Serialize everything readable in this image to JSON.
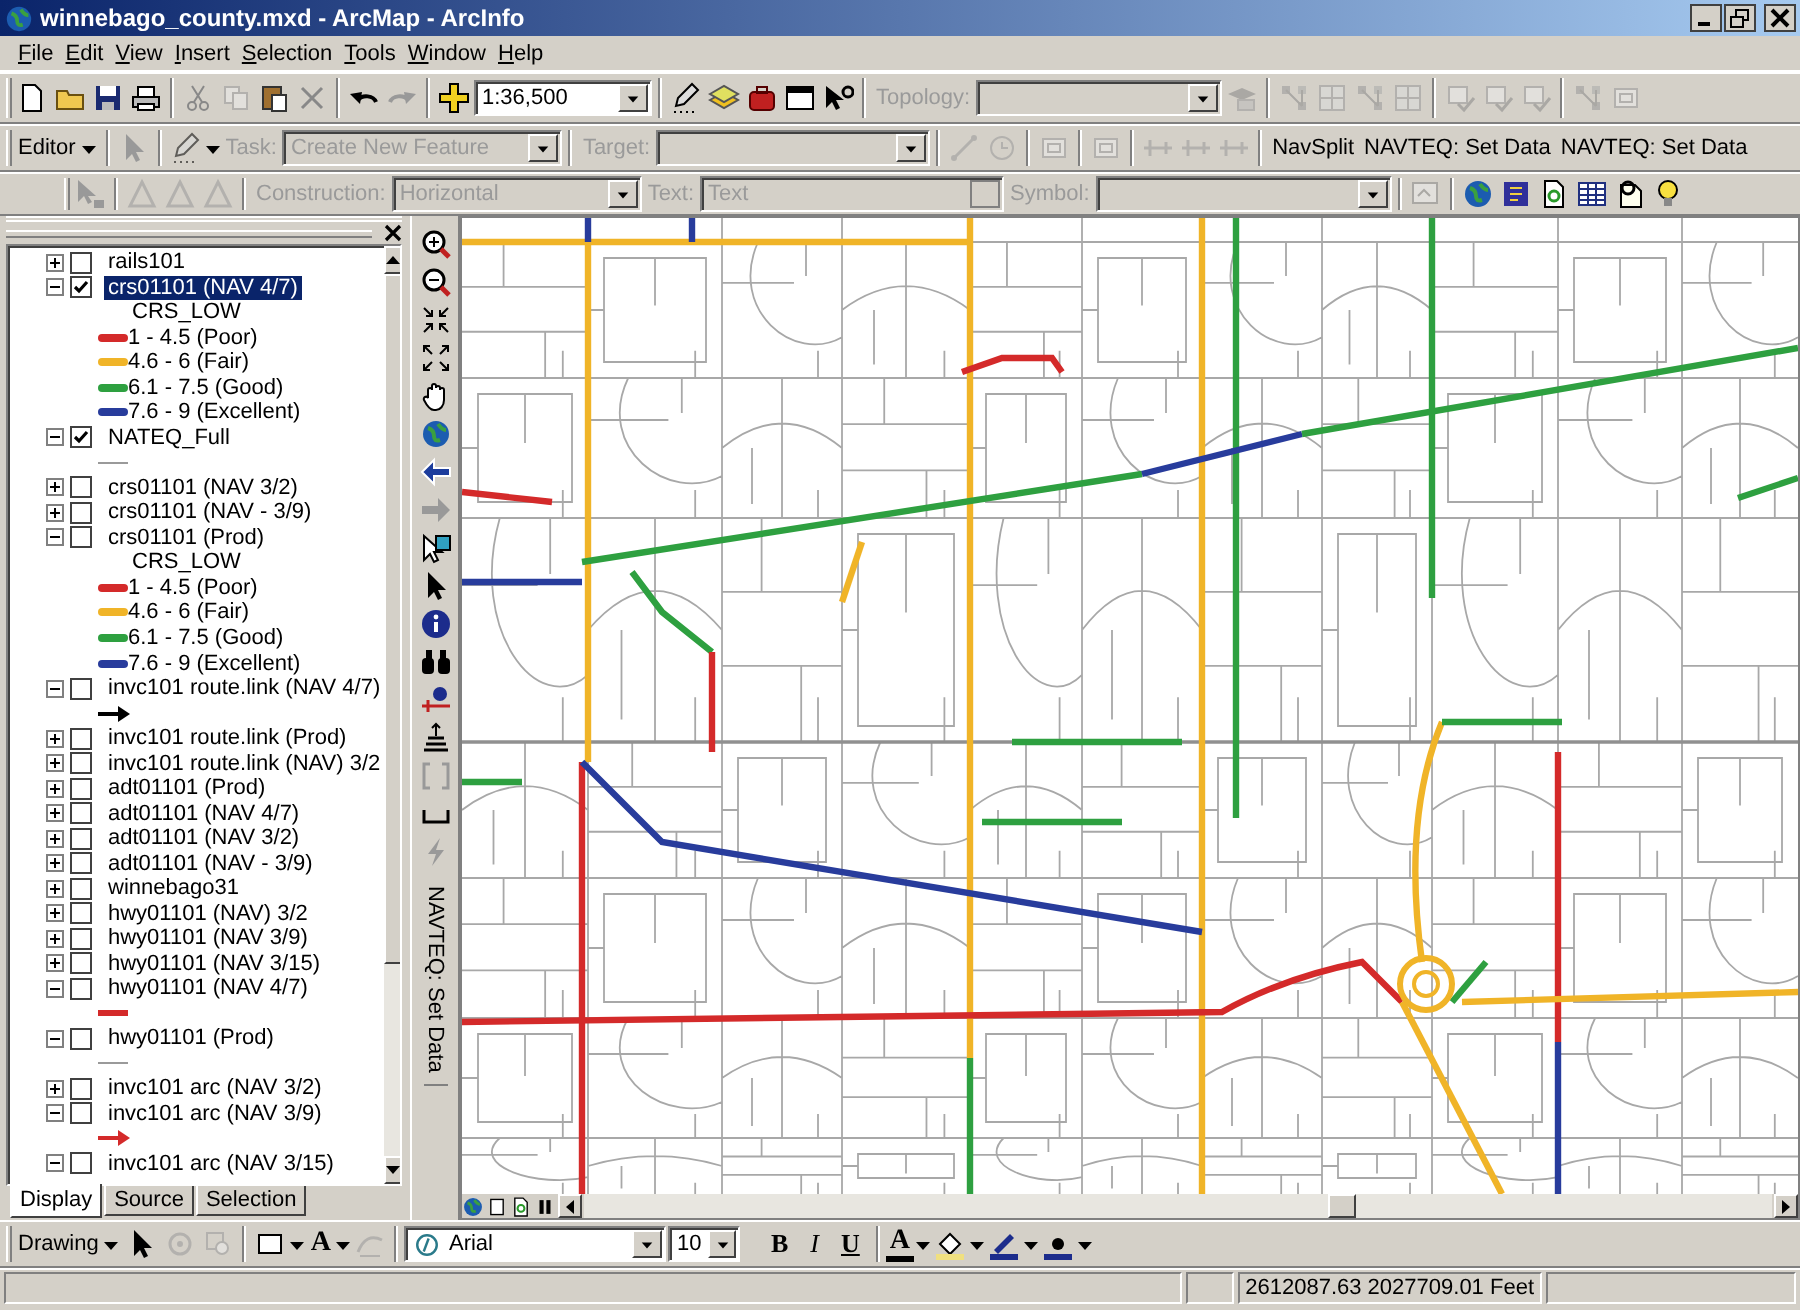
{
  "window": {
    "title": "winnebago_county.mxd - ArcMap - ArcInfo"
  },
  "menu": [
    {
      "label": "File"
    },
    {
      "label": "Edit"
    },
    {
      "label": "View"
    },
    {
      "label": "Insert"
    },
    {
      "label": "Selection"
    },
    {
      "label": "Tools"
    },
    {
      "label": "Window"
    },
    {
      "label": "Help"
    }
  ],
  "standard_toolbar": {
    "scale": "1:36,500"
  },
  "topology_toolbar": {
    "label": "Topology:",
    "disabled": true
  },
  "editor_toolbar": {
    "editor": "Editor",
    "task_label": "Task:",
    "task": "Create New Feature",
    "target_label": "Target:",
    "disabled": true,
    "buttons": [
      "NavSplit",
      "NAVTEQ: Set Data",
      "NAVTEQ: Set Data"
    ]
  },
  "annotation_toolbar": {
    "construction_label": "Construction:",
    "construction": "Horizontal",
    "text_label": "Text:",
    "text": "Text",
    "symbol_label": "Symbol:",
    "disabled": true
  },
  "toc": {
    "layers": [
      {
        "name": "rails101",
        "expanded": false,
        "checked": false,
        "selected": false
      },
      {
        "name": "crs01101 (NAV 4/7)",
        "expanded": true,
        "checked": true,
        "selected": true,
        "legend": [
          {
            "kind": "heading",
            "label": "CRS_LOW"
          },
          {
            "kind": "swatch",
            "color": "#d42a2a",
            "label": "1 - 4.5  (Poor)"
          },
          {
            "kind": "swatch",
            "color": "#f0b428",
            "label": "4.6 - 6  (Fair)"
          },
          {
            "kind": "swatch",
            "color": "#2ea040",
            "label": "6.1 - 7.5  (Good)"
          },
          {
            "kind": "swatch",
            "color": "#283c9c",
            "label": "7.6 - 9  (Excellent)"
          }
        ]
      },
      {
        "name": "NATEQ_Full",
        "expanded": true,
        "checked": true,
        "selected": false,
        "legend": [
          {
            "kind": "line",
            "color": "#9a9a9a"
          }
        ]
      },
      {
        "name": "crs01101 (NAV 3/2)",
        "expanded": false,
        "checked": false,
        "selected": false
      },
      {
        "name": "crs01101 (NAV - 3/9)",
        "expanded": false,
        "checked": false,
        "selected": false
      },
      {
        "name": "crs01101 (Prod)",
        "expanded": true,
        "checked": false,
        "selected": false,
        "legend": [
          {
            "kind": "heading",
            "label": "CRS_LOW"
          },
          {
            "kind": "swatch",
            "color": "#d42a2a",
            "label": "1 - 4.5  (Poor)"
          },
          {
            "kind": "swatch",
            "color": "#f0b428",
            "label": "4.6 - 6  (Fair)"
          },
          {
            "kind": "swatch",
            "color": "#2ea040",
            "label": "6.1 - 7.5  (Good)"
          },
          {
            "kind": "swatch",
            "color": "#283c9c",
            "label": "7.6 - 9  (Excellent)"
          }
        ]
      },
      {
        "name": "invc101 route.link (NAV 4/7)",
        "expanded": true,
        "checked": false,
        "selected": false,
        "legend": [
          {
            "kind": "arrow",
            "color": "#000000"
          }
        ]
      },
      {
        "name": "invc101 route.link (Prod)",
        "expanded": false,
        "checked": false,
        "selected": false
      },
      {
        "name": "invc101 route.link (NAV) 3/2",
        "expanded": false,
        "checked": false,
        "selected": false
      },
      {
        "name": "adt01101 (Prod)",
        "expanded": false,
        "checked": false,
        "selected": false
      },
      {
        "name": "adt01101 (NAV 4/7)",
        "expanded": false,
        "checked": false,
        "selected": false
      },
      {
        "name": "adt01101 (NAV 3/2)",
        "expanded": false,
        "checked": false,
        "selected": false
      },
      {
        "name": "adt01101 (NAV - 3/9)",
        "expanded": false,
        "checked": false,
        "selected": false
      },
      {
        "name": "winnebago31",
        "expanded": false,
        "checked": false,
        "selected": false
      },
      {
        "name": "hwy01101 (NAV) 3/2",
        "expanded": false,
        "checked": false,
        "selected": false
      },
      {
        "name": "hwy01101 (NAV 3/9)",
        "expanded": false,
        "checked": false,
        "selected": false
      },
      {
        "name": "hwy01101 (NAV 3/15)",
        "expanded": false,
        "checked": false,
        "selected": false
      },
      {
        "name": "hwy01101 (NAV 4/7)",
        "expanded": true,
        "checked": false,
        "selected": false,
        "legend": [
          {
            "kind": "thick_line",
            "color": "#d42a2a"
          }
        ]
      },
      {
        "name": "hwy01101 (Prod)",
        "expanded": true,
        "checked": false,
        "selected": false,
        "legend": [
          {
            "kind": "line",
            "color": "#9a9a9a"
          }
        ]
      },
      {
        "name": "invc101 arc (NAV 3/2)",
        "expanded": false,
        "checked": false,
        "selected": false
      },
      {
        "name": "invc101 arc (NAV 3/9)",
        "expanded": true,
        "checked": false,
        "selected": false,
        "legend": [
          {
            "kind": "arrow",
            "color": "#d42a2a"
          }
        ]
      },
      {
        "name": "invc101 arc (NAV 3/15)",
        "expanded": true,
        "checked": false,
        "selected": false
      }
    ],
    "tabs": [
      {
        "label": "Display",
        "selected": true
      },
      {
        "label": "Source",
        "selected": false
      },
      {
        "label": "Selection",
        "selected": false
      }
    ]
  },
  "tools_toolbar": {
    "vertical_button": "NAVTEQ: Set Data"
  },
  "drawing_toolbar": {
    "menu": "Drawing",
    "new_text": "A",
    "font": "Arial",
    "size": "10",
    "format_buttons": [
      {
        "label": "B",
        "kind": "bold"
      },
      {
        "label": "I",
        "kind": "italic"
      },
      {
        "label": "U",
        "kind": "underline"
      }
    ],
    "font_color": "A"
  },
  "status_bar": {
    "coordinates": "2612087.63  2027709.01 Feet"
  }
}
